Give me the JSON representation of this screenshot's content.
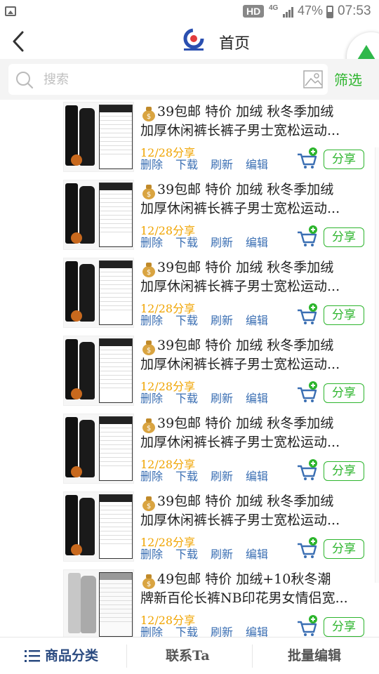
{
  "status_bar": {
    "hd": "HD",
    "network": "4G",
    "battery": "47%",
    "time": "07:53"
  },
  "header": {
    "title": "首页"
  },
  "search": {
    "placeholder": "搜索",
    "filter_label": "筛选"
  },
  "items": [
    {
      "title_line1": "39包邮 特价 加绒 秋冬季加绒",
      "title_line2": "加厚休闲裤长裤子男士宽松运动...",
      "share_date": "12/28分享",
      "actions": [
        "删除",
        "下载",
        "刷新",
        "编辑"
      ],
      "share_label": "分享"
    },
    {
      "title_line1": "39包邮 特价 加绒 秋冬季加绒",
      "title_line2": "加厚休闲裤长裤子男士宽松运动...",
      "share_date": "12/28分享",
      "actions": [
        "删除",
        "下载",
        "刷新",
        "编辑"
      ],
      "share_label": "分享"
    },
    {
      "title_line1": "39包邮 特价 加绒 秋冬季加绒",
      "title_line2": "加厚休闲裤长裤子男士宽松运动...",
      "share_date": "12/28分享",
      "actions": [
        "删除",
        "下载",
        "刷新",
        "编辑"
      ],
      "share_label": "分享"
    },
    {
      "title_line1": "39包邮 特价 加绒 秋冬季加绒",
      "title_line2": "加厚休闲裤长裤子男士宽松运动...",
      "share_date": "12/28分享",
      "actions": [
        "删除",
        "下载",
        "刷新",
        "编辑"
      ],
      "share_label": "分享"
    },
    {
      "title_line1": "39包邮 特价 加绒 秋冬季加绒",
      "title_line2": "加厚休闲裤长裤子男士宽松运动...",
      "share_date": "12/28分享",
      "actions": [
        "删除",
        "下载",
        "刷新",
        "编辑"
      ],
      "share_label": "分享"
    },
    {
      "title_line1": "39包邮 特价 加绒 秋冬季加绒",
      "title_line2": "加厚休闲裤长裤子男士宽松运动...",
      "share_date": "12/28分享",
      "actions": [
        "删除",
        "下载",
        "刷新",
        "编辑"
      ],
      "share_label": "分享"
    },
    {
      "title_line1": "49包邮 特价 加绒+10秋冬潮",
      "title_line2": "牌新百伦长裤NB印花男女情侣宽...",
      "share_date": "12/28分享",
      "actions": [
        "删除",
        "下载",
        "刷新",
        "编辑"
      ],
      "share_label": "分享"
    }
  ],
  "bottom_bar": {
    "tab1": "商品分类",
    "tab2": "联系Ta",
    "tab3": "批量编辑"
  },
  "colors": {
    "accent_green": "#2db52d",
    "action_blue": "#3b6fb3",
    "date_orange": "#f0a400",
    "tab_active": "#2a4a80"
  },
  "icons": [
    "back-icon",
    "logo-icon",
    "search-icon",
    "image-icon",
    "money-bag-icon",
    "cart-add-icon",
    "menu-icon"
  ]
}
